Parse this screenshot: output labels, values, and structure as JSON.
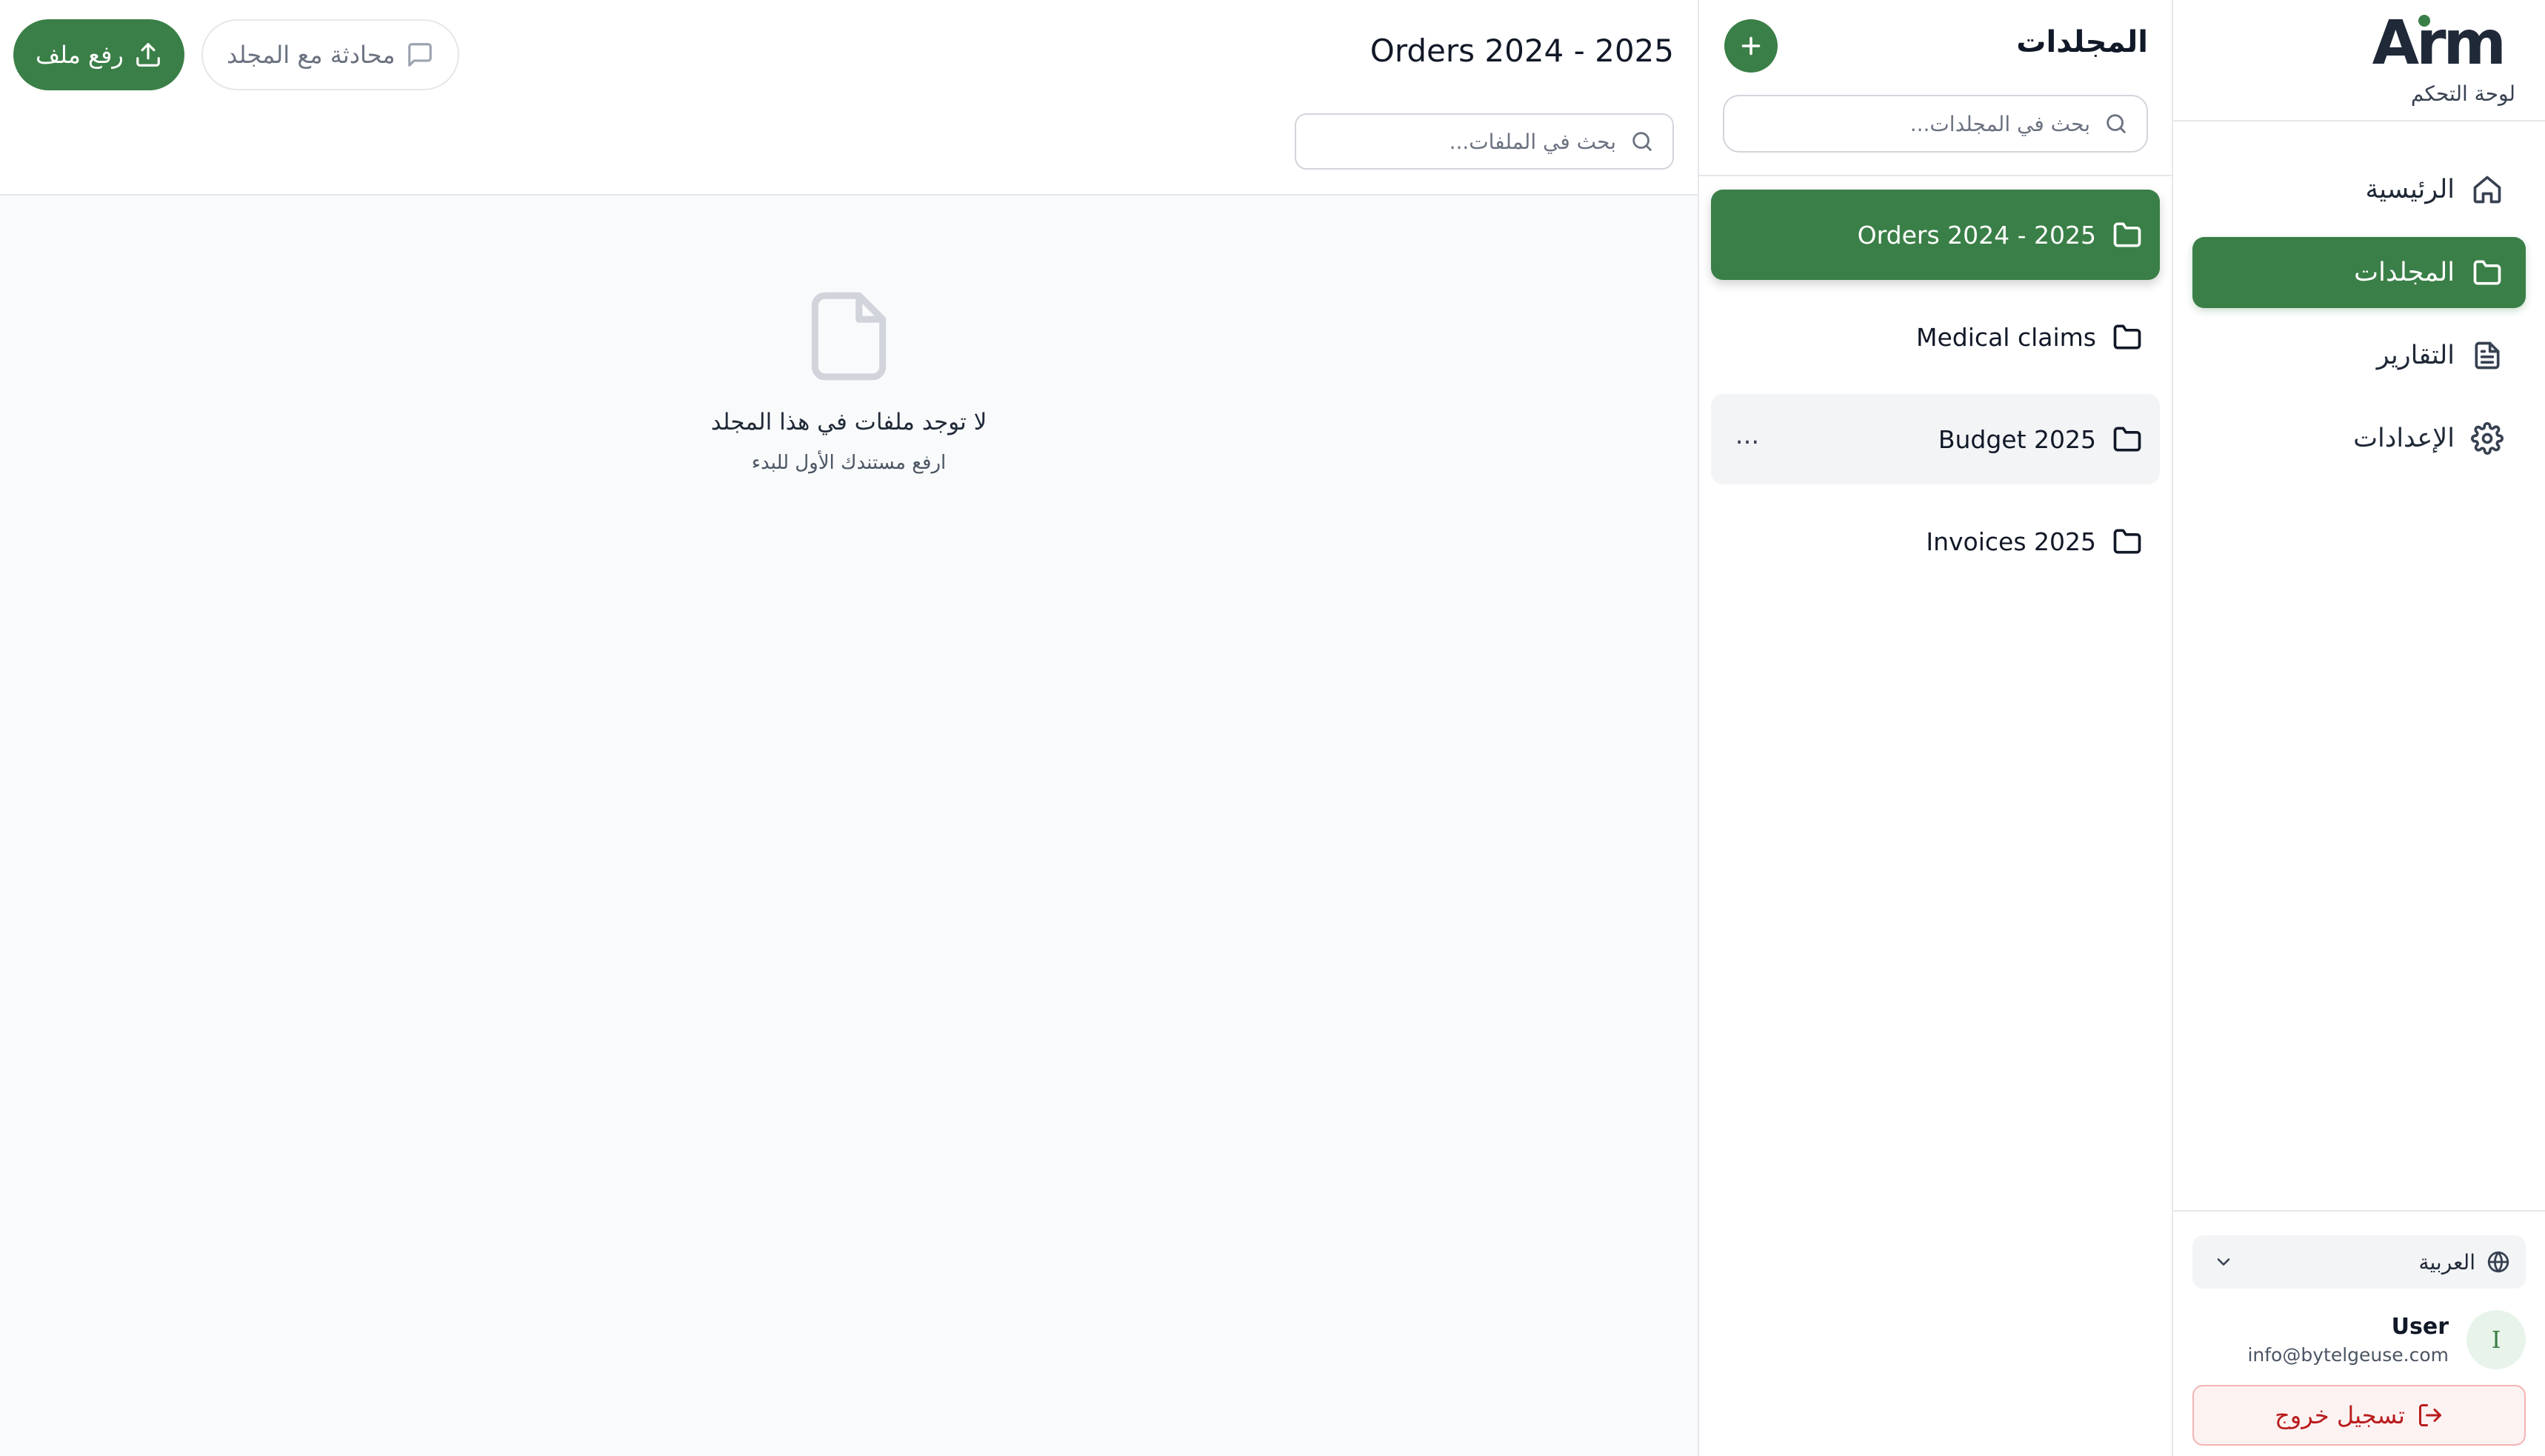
{
  "brand": {
    "logo": "Arm",
    "subtitle": "لوحة التحكم"
  },
  "nav": {
    "items": [
      {
        "label": "الرئيسية",
        "icon": "home-icon",
        "active": false
      },
      {
        "label": "المجلدات",
        "icon": "folder-icon",
        "active": true
      },
      {
        "label": "التقارير",
        "icon": "document-icon",
        "active": false
      },
      {
        "label": "الإعدادات",
        "icon": "gear-icon",
        "active": false
      }
    ]
  },
  "footer": {
    "language": "العربية",
    "user_initial": "I",
    "user_name": "User",
    "user_email": "info@bytelgeuse.com",
    "logout_label": "تسجيل خروج"
  },
  "folders": {
    "title": "المجلدات",
    "search_placeholder": "بحث في المجلدات...",
    "items": [
      {
        "name": "Orders 2024 - 2025",
        "state": "active"
      },
      {
        "name": "Medical claims",
        "state": "normal"
      },
      {
        "name": "Budget 2025",
        "state": "hover"
      },
      {
        "name": "Invoices 2025",
        "state": "normal"
      }
    ],
    "more_label": "..."
  },
  "main": {
    "title": "Orders 2024 - 2025",
    "search_placeholder": "بحث في الملفات...",
    "upload_label": "رفع ملف",
    "chat_label": "محادثة مع المجلد",
    "empty_title": "لا توجد ملفات في هذا المجلد",
    "empty_subtitle": "ارفع مستندك الأول للبدء"
  },
  "colors": {
    "accent": "#3a7f47",
    "danger": "#b91c1c",
    "border": "#e5e7eb",
    "background": "#f9fafb"
  }
}
